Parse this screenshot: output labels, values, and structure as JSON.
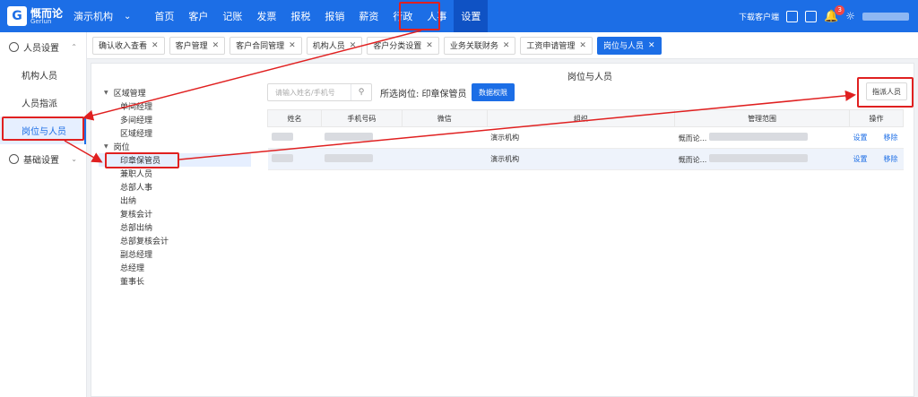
{
  "app": {
    "logo_cn": "慨而论",
    "logo_en": "Gerlun",
    "logo_mark": "G",
    "org": "演示机构"
  },
  "nav": [
    "首页",
    "客户",
    "记账",
    "发票",
    "报税",
    "报销",
    "薪资",
    "行政",
    "人事",
    "设置"
  ],
  "top_right": {
    "download": "下载客户端",
    "notification_count": "3"
  },
  "sidebar": {
    "group1": "人员设置",
    "items": [
      "机构人员",
      "人员指派",
      "岗位与人员"
    ],
    "group2": "基础设置"
  },
  "tabs": [
    "确认收入查看",
    "客户管理",
    "客户合同管理",
    "机构人员",
    "客户分类设置",
    "业务关联财务",
    "工资申请管理",
    "岗位与人员"
  ],
  "tree": {
    "region": "区域管理",
    "region_children": [
      "单间经理",
      "多间经理",
      "区域经理"
    ],
    "post": "岗位",
    "post_children": [
      "印章保管员",
      "兼职人员",
      "总部人事",
      "出纳",
      "复核会计",
      "总部出纳",
      "总部复核会计",
      "副总经理",
      "总经理",
      "董事长"
    ]
  },
  "main": {
    "title": "岗位与人员",
    "search_placeholder": "请输入姓名/手机号",
    "selected_label": "所选岗位: 印章保管员",
    "data_perm_btn": "数据权限",
    "assign_btn": "指派人员"
  },
  "table": {
    "headers": [
      "姓名",
      "手机号码",
      "微信",
      "组织",
      "管理范围",
      "操作"
    ],
    "rows": [
      {
        "org": "演示机构",
        "scope": "慨而论...",
        "action_set": "设置",
        "action_remove": "移除"
      },
      {
        "org": "演示机构",
        "scope": "慨而论...",
        "action_set": "设置",
        "action_remove": "移除"
      }
    ]
  }
}
